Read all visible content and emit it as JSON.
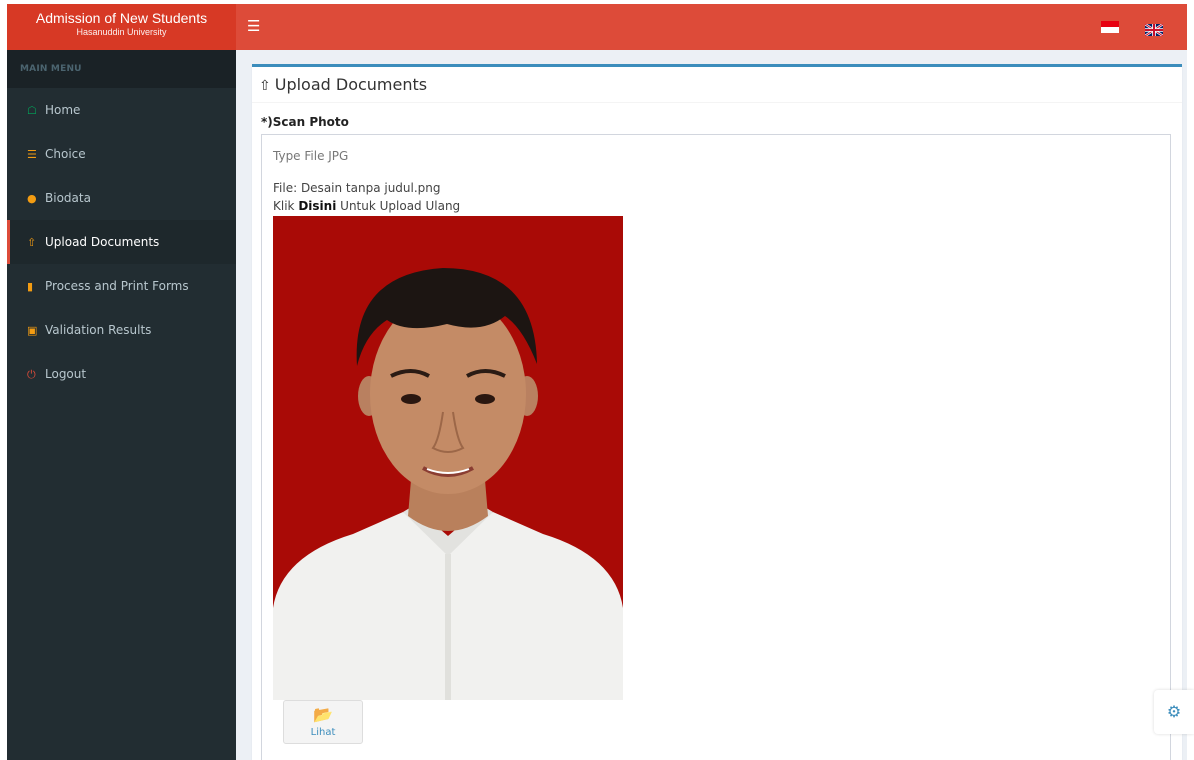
{
  "brand": {
    "title": "Admission of New Students",
    "subtitle": "Hasanuddin University"
  },
  "header": {
    "menu_icon": "bars-icon",
    "languages": [
      "indonesian-flag-icon",
      "uk-flag-icon"
    ],
    "accent_color": "#dd4b39"
  },
  "sidebar": {
    "header": "MAIN MENU",
    "items": [
      {
        "label": "Home",
        "icon": "home-icon"
      },
      {
        "label": "Choice",
        "icon": "list-icon"
      },
      {
        "label": "Biodata",
        "icon": "user-icon"
      },
      {
        "label": "Upload Documents",
        "icon": "upload-icon",
        "active": true
      },
      {
        "label": "Process and Print Forms",
        "icon": "book-icon"
      },
      {
        "label": "Validation Results",
        "icon": "id-card-icon"
      },
      {
        "label": "Logout",
        "icon": "power-icon"
      }
    ]
  },
  "page": {
    "title": "Upload Documents",
    "field_label": "*)Scan Photo",
    "file_type": "Type File JPG",
    "file_name": "File: Desain tanpa judul.png",
    "reupload_prefix": "Klik",
    "reupload_link": "Disini",
    "reupload_suffix": "Untuk Upload Ulang",
    "view_button": "Lihat"
  }
}
